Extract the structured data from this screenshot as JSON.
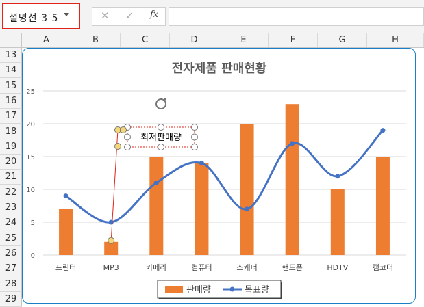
{
  "name_box": {
    "value": "설명선 3 5"
  },
  "formula_bar": {
    "cancel_icon": "✕",
    "enter_icon": "✓",
    "fx_label": "fx",
    "value": ""
  },
  "columns": [
    "A",
    "B",
    "C",
    "D",
    "E",
    "F",
    "G",
    "H"
  ],
  "rows": [
    "13",
    "14",
    "15",
    "16",
    "17",
    "18",
    "19",
    "20",
    "21",
    "22",
    "23",
    "24",
    "25",
    "26",
    "27",
    "28",
    "29"
  ],
  "callout": {
    "text": "최저판매량"
  },
  "colors": {
    "bar": "#ed7d31",
    "line": "#4472c4",
    "selection": "#e2231a",
    "chart_border": "#1a7fc4"
  },
  "chart_data": {
    "type": "bar",
    "title": "전자제품 판매현황",
    "categories": [
      "프린터",
      "MP3",
      "카메라",
      "컴퓨터",
      "스캐너",
      "핸드폰",
      "HDTV",
      "캠코더"
    ],
    "series": [
      {
        "name": "판매량",
        "type": "bar",
        "values": [
          7,
          2,
          15,
          14,
          20,
          23,
          10,
          15
        ]
      },
      {
        "name": "목표량",
        "type": "line",
        "smooth": true,
        "values": [
          9,
          5,
          11,
          14,
          7,
          17,
          12,
          19
        ]
      }
    ],
    "yticks": [
      "0",
      "5",
      "10",
      "15",
      "20",
      "25"
    ],
    "ylim": [
      0,
      25
    ],
    "grid": true,
    "legend": "bottom"
  }
}
